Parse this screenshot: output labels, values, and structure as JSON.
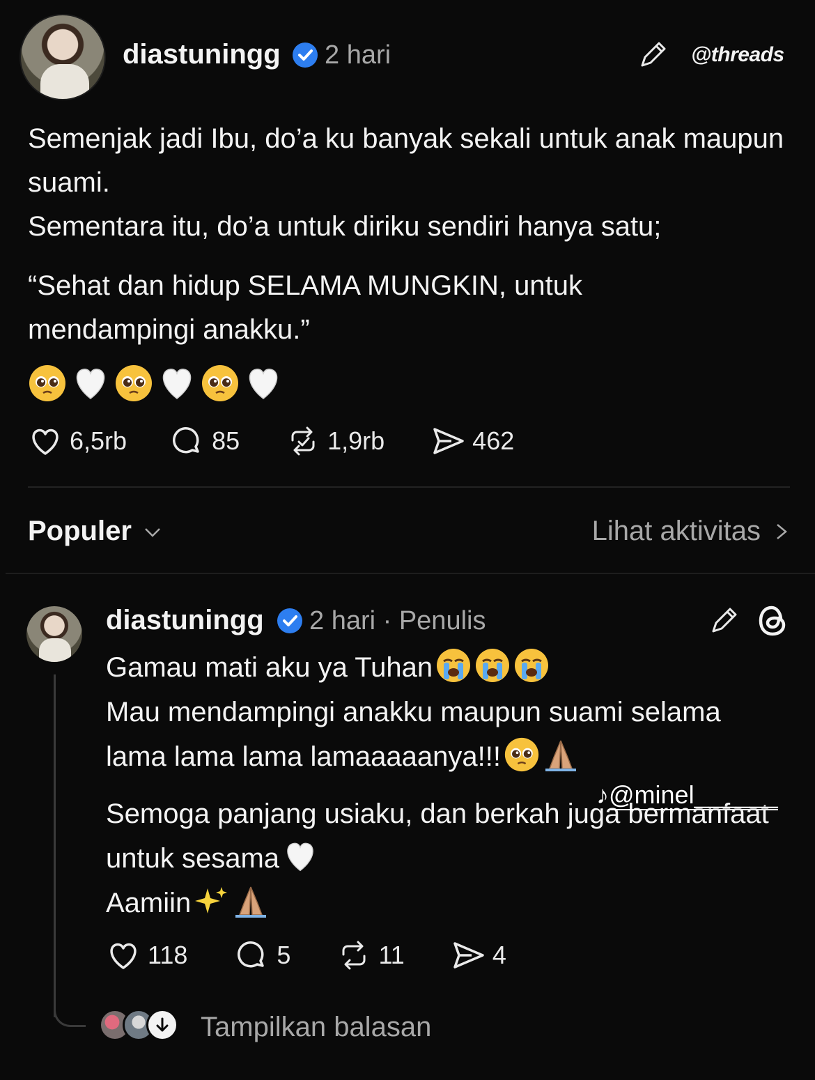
{
  "post": {
    "username": "diastuningg",
    "time": "2 hari",
    "brand": "threads",
    "paragraphs": [
      "Semenjak jadi Ibu, do’a ku banyak sekali untuk anak maupun suami.",
      "Sementara itu, do’a untuk diriku sendiri hanya satu;",
      "“Sehat dan hidup SELAMA MUNGKIN, untuk mendampingi anakku.”"
    ],
    "emojis": [
      "pleading-face",
      "white-heart",
      "pleading-face",
      "white-heart",
      "pleading-face",
      "white-heart"
    ],
    "stats": {
      "likes": "6,5rb",
      "comments": "85",
      "reposts": "1,9rb",
      "shares": "462"
    }
  },
  "sort": {
    "label": "Populer",
    "activity_link": "Lihat aktivitas"
  },
  "reply": {
    "username": "diastuningg",
    "meta": "2 hari · Penulis",
    "lines": [
      "Gamau mati aku ya Tuhan",
      "Mau mendampingi anakku maupun suami selama lama lama lama lamaaaaanya!!!",
      "Semoga panjang usiaku, dan berkah juga bermanfaat untuk sesama",
      "Aamiin"
    ],
    "stats": {
      "likes": "118",
      "comments": "5",
      "reposts": "11",
      "shares": "4"
    },
    "show_replies": "Tampilkan balasan"
  },
  "watermark": {
    "handle": "@minel______"
  },
  "colors": {
    "background": "#0a0a0a",
    "verified": "#2d7ef0",
    "muted": "#a8a8a8"
  }
}
